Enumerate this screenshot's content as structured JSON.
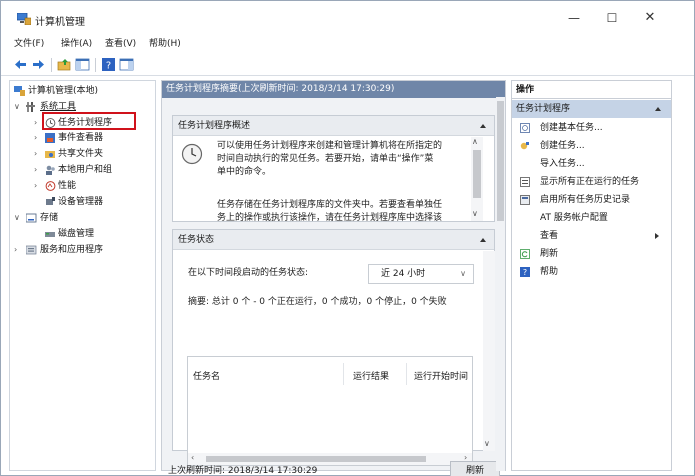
{
  "window": {
    "title": "计算机管理",
    "min_glyph": "—",
    "max_glyph": "☐",
    "close_glyph": "✕"
  },
  "menu": [
    "文件(F)",
    "操作(A)",
    "查看(V)",
    "帮助(H)"
  ],
  "toolbar_icons": [
    "back-arrow-icon",
    "forward-arrow-icon",
    "folder-up-icon",
    "show-hide-tree-icon",
    "help-icon",
    "console-view-icon"
  ],
  "tree": {
    "root": "计算机管理(本地)",
    "system_tools": "系统工具",
    "task_scheduler": "任务计划程序",
    "event_viewer": "事件查看器",
    "shared_folders": "共享文件夹",
    "local_users": "本地用户和组",
    "performance": "性能",
    "device_manager": "设备管理器",
    "storage": "存储",
    "disk_management": "磁盘管理",
    "services_apps": "服务和应用程序"
  },
  "center": {
    "header": "任务计划程序摘要(上次刷新时间: 2018/3/14 17:30:29)",
    "overview_title": "任务计划程序概述",
    "overview_p1_l1": "可以使用任务计划程序来创建和管理计算机将在所指定的",
    "overview_p1_l2": "时间自动执行的常见任务。若要开始，请单击“操作”菜",
    "overview_p1_l3": "单中的命令。",
    "overview_p2_l1": "任务存储在任务计划程序库的文件夹中。若要查看单独任",
    "overview_p2_l2": "务上的操作或执行该操作，请在任务计划程序库中选择该",
    "status_title": "任务状态",
    "status_label": "在以下时间段启动的任务状态:",
    "status_range": "近 24 小时",
    "summary": "摘要: 总计 0 个 - 0 个正在运行，0 个成功，0 个停止，0 个失败",
    "col_task_name": "任务名",
    "col_run_result": "运行结果",
    "col_run_start": "运行开始时间",
    "last_refresh": "上次刷新时间: 2018/3/14 17:30:29",
    "refresh_button": "刷新"
  },
  "actions": {
    "title": "操作",
    "group": "任务计划程序",
    "items": [
      {
        "label": "创建基本任务...",
        "icon": "create-basic-task-icon"
      },
      {
        "label": "创建任务...",
        "icon": "create-task-icon"
      },
      {
        "label": "导入任务...",
        "icon": ""
      },
      {
        "label": "显示所有正在运行的任务",
        "icon": "running-tasks-icon"
      },
      {
        "label": "启用所有任务历史记录",
        "icon": "history-icon"
      },
      {
        "label": "AT 服务帐户配置",
        "icon": ""
      },
      {
        "label": "查看",
        "icon": ""
      },
      {
        "label": "刷新",
        "icon": "refresh-icon"
      },
      {
        "label": "帮助",
        "icon": "help-icon"
      }
    ]
  }
}
